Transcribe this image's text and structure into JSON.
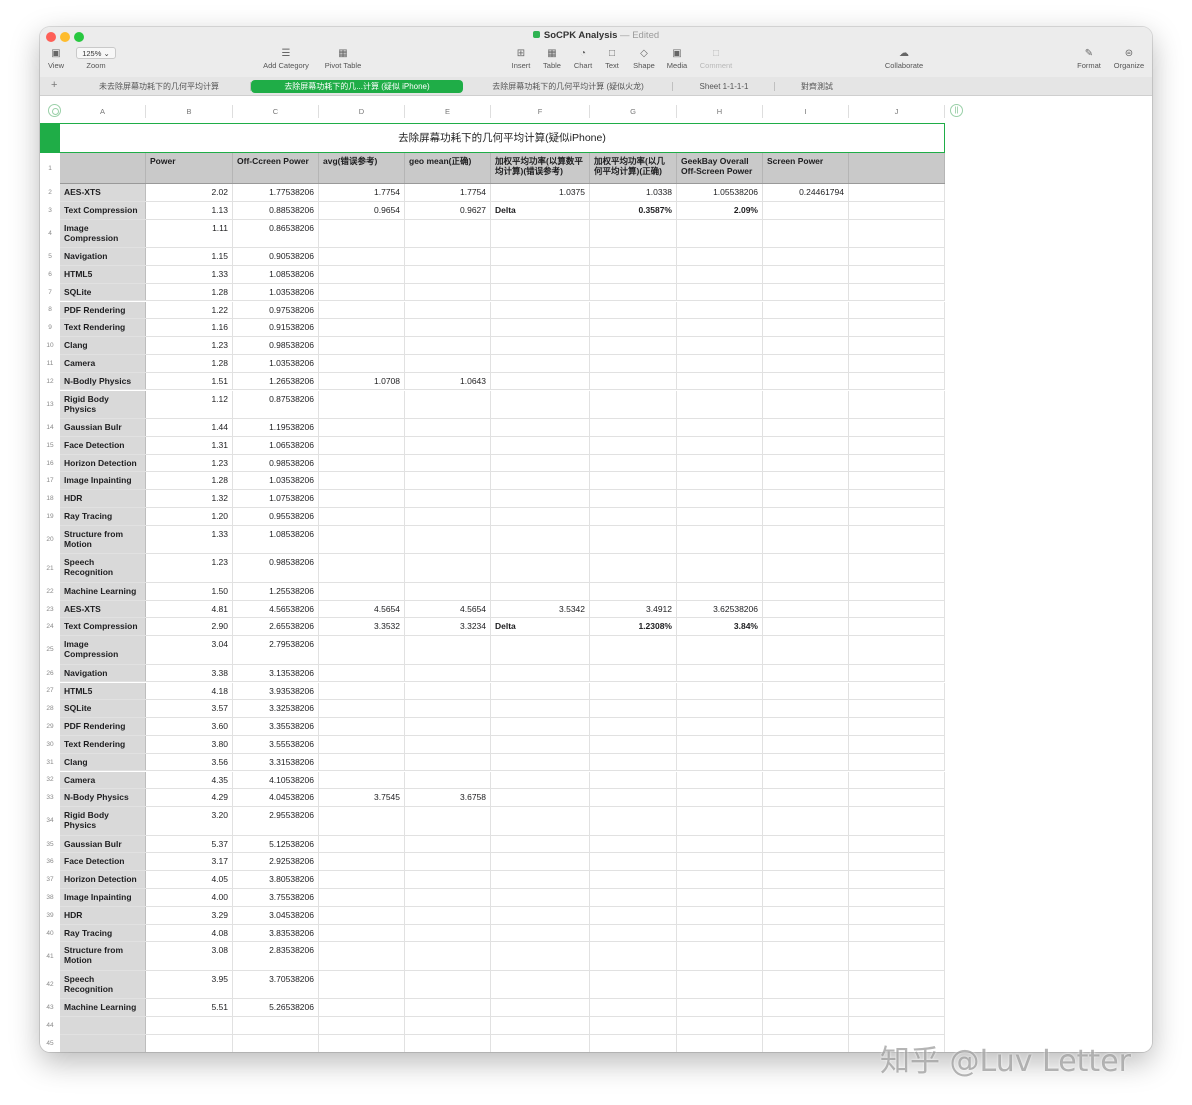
{
  "window": {
    "title": "SoCPK Analysis",
    "status": "Edited"
  },
  "toolbar": {
    "view": "View",
    "zoom_value": "125%",
    "zoom": "Zoom",
    "add_category": "Add Category",
    "pivot_table": "Pivot Table",
    "insert": "Insert",
    "table": "Table",
    "chart": "Chart",
    "text": "Text",
    "shape": "Shape",
    "media": "Media",
    "comment": "Comment",
    "collaborate": "Collaborate",
    "format": "Format",
    "organize": "Organize"
  },
  "sheets": [
    "未去除屏幕功耗下的几何平均计算",
    "去除屏幕功耗下的几...计算 (疑似 iPhone)",
    "去除屏幕功耗下的几何平均计算 (疑似火龙)",
    "Sheet 1-1-1-1",
    "對齊測試"
  ],
  "columns": [
    "A",
    "B",
    "C",
    "D",
    "E",
    "F",
    "G",
    "H",
    "I",
    "J"
  ],
  "table_title": "去除屏幕功耗下的几何平均计算(疑似iPhone)",
  "header": [
    "",
    "Power",
    "Off-Ccreen Power",
    "avg(错误参考)",
    "geo mean(正确)",
    "加权平均功率(以算数平均计算)(错误参考)",
    "加权平均功率(以几何平均计算)(正确)",
    "GeekBay Overall Off-Screen Power",
    "Screen Power",
    ""
  ],
  "rows": [
    [
      "AES-XTS",
      "2.02",
      "1.77538206",
      "1.7754",
      "1.7754",
      "1.0375",
      "1.0338",
      "1.05538206",
      "0.24461794",
      ""
    ],
    [
      "Text Compression",
      "1.13",
      "0.88538206",
      "0.9654",
      "0.9627",
      "Delta",
      "0.3587%",
      "2.09%",
      "",
      ""
    ],
    [
      "Image Compression",
      "1.11",
      "0.86538206",
      "",
      "",
      "",
      "",
      "",
      "",
      ""
    ],
    [
      "Navigation",
      "1.15",
      "0.90538206",
      "",
      "",
      "",
      "",
      "",
      "",
      ""
    ],
    [
      "HTML5",
      "1.33",
      "1.08538206",
      "",
      "",
      "",
      "",
      "",
      "",
      ""
    ],
    [
      "SQLite",
      "1.28",
      "1.03538206",
      "",
      "",
      "",
      "",
      "",
      "",
      ""
    ],
    [
      "PDF Rendering",
      "1.22",
      "0.97538206",
      "",
      "",
      "",
      "",
      "",
      "",
      ""
    ],
    [
      "Text Rendering",
      "1.16",
      "0.91538206",
      "",
      "",
      "",
      "",
      "",
      "",
      ""
    ],
    [
      "Clang",
      "1.23",
      "0.98538206",
      "",
      "",
      "",
      "",
      "",
      "",
      ""
    ],
    [
      "Camera",
      "1.28",
      "1.03538206",
      "",
      "",
      "",
      "",
      "",
      "",
      ""
    ],
    [
      "N-Bodly Physics",
      "1.51",
      "1.26538206",
      "1.0708",
      "1.0643",
      "",
      "",
      "",
      "",
      ""
    ],
    [
      "Rigid Body Physics",
      "1.12",
      "0.87538206",
      "",
      "",
      "",
      "",
      "",
      "",
      ""
    ],
    [
      "Gaussian Bulr",
      "1.44",
      "1.19538206",
      "",
      "",
      "",
      "",
      "",
      "",
      ""
    ],
    [
      "Face Detection",
      "1.31",
      "1.06538206",
      "",
      "",
      "",
      "",
      "",
      "",
      ""
    ],
    [
      "Horizon Detection",
      "1.23",
      "0.98538206",
      "",
      "",
      "",
      "",
      "",
      "",
      ""
    ],
    [
      "Image Inpainting",
      "1.28",
      "1.03538206",
      "",
      "",
      "",
      "",
      "",
      "",
      ""
    ],
    [
      "HDR",
      "1.32",
      "1.07538206",
      "",
      "",
      "",
      "",
      "",
      "",
      ""
    ],
    [
      "Ray Tracing",
      "1.20",
      "0.95538206",
      "",
      "",
      "",
      "",
      "",
      "",
      ""
    ],
    [
      "Structure from Motion",
      "1.33",
      "1.08538206",
      "",
      "",
      "",
      "",
      "",
      "",
      ""
    ],
    [
      "Speech Recognition",
      "1.23",
      "0.98538206",
      "",
      "",
      "",
      "",
      "",
      "",
      ""
    ],
    [
      "Machine Learning",
      "1.50",
      "1.25538206",
      "",
      "",
      "",
      "",
      "",
      "",
      ""
    ],
    [
      "AES-XTS",
      "4.81",
      "4.56538206",
      "4.5654",
      "4.5654",
      "3.5342",
      "3.4912",
      "3.62538206",
      "",
      ""
    ],
    [
      "Text Compression",
      "2.90",
      "2.65538206",
      "3.3532",
      "3.3234",
      "Delta",
      "1.2308%",
      "3.84%",
      "",
      ""
    ],
    [
      "Image Compression",
      "3.04",
      "2.79538206",
      "",
      "",
      "",
      "",
      "",
      "",
      ""
    ],
    [
      "Navigation",
      "3.38",
      "3.13538206",
      "",
      "",
      "",
      "",
      "",
      "",
      ""
    ],
    [
      "HTML5",
      "4.18",
      "3.93538206",
      "",
      "",
      "",
      "",
      "",
      "",
      ""
    ],
    [
      "SQLite",
      "3.57",
      "3.32538206",
      "",
      "",
      "",
      "",
      "",
      "",
      ""
    ],
    [
      "PDF Rendering",
      "3.60",
      "3.35538206",
      "",
      "",
      "",
      "",
      "",
      "",
      ""
    ],
    [
      "Text Rendering",
      "3.80",
      "3.55538206",
      "",
      "",
      "",
      "",
      "",
      "",
      ""
    ],
    [
      "Clang",
      "3.56",
      "3.31538206",
      "",
      "",
      "",
      "",
      "",
      "",
      ""
    ],
    [
      "Camera",
      "4.35",
      "4.10538206",
      "",
      "",
      "",
      "",
      "",
      "",
      ""
    ],
    [
      "N-Body Physics",
      "4.29",
      "4.04538206",
      "3.7545",
      "3.6758",
      "",
      "",
      "",
      "",
      ""
    ],
    [
      "Rigid Body Physics",
      "3.20",
      "2.95538206",
      "",
      "",
      "",
      "",
      "",
      "",
      ""
    ],
    [
      "Gaussian Bulr",
      "5.37",
      "5.12538206",
      "",
      "",
      "",
      "",
      "",
      "",
      ""
    ],
    [
      "Face Detection",
      "3.17",
      "2.92538206",
      "",
      "",
      "",
      "",
      "",
      "",
      ""
    ],
    [
      "Horizon Detection",
      "4.05",
      "3.80538206",
      "",
      "",
      "",
      "",
      "",
      "",
      ""
    ],
    [
      "Image Inpainting",
      "4.00",
      "3.75538206",
      "",
      "",
      "",
      "",
      "",
      "",
      ""
    ],
    [
      "HDR",
      "3.29",
      "3.04538206",
      "",
      "",
      "",
      "",
      "",
      "",
      ""
    ],
    [
      "Ray Tracing",
      "4.08",
      "3.83538206",
      "",
      "",
      "",
      "",
      "",
      "",
      ""
    ],
    [
      "Structure from Motion",
      "3.08",
      "2.83538206",
      "",
      "",
      "",
      "",
      "",
      "",
      ""
    ],
    [
      "Speech Recognition",
      "3.95",
      "3.70538206",
      "",
      "",
      "",
      "",
      "",
      "",
      ""
    ],
    [
      "Machine Learning",
      "5.51",
      "5.26538206",
      "",
      "",
      "",
      "",
      "",
      "",
      ""
    ],
    [
      "",
      "",
      "",
      "",
      "",
      "",
      "",
      "",
      "",
      ""
    ],
    [
      "",
      "",
      "",
      "",
      "",
      "",
      "",
      "",
      "",
      ""
    ]
  ],
  "bold_cells": [
    [
      1,
      6
    ],
    [
      1,
      7
    ],
    [
      1,
      8
    ],
    [
      22,
      6
    ],
    [
      22,
      7
    ]
  ],
  "watermark": "知乎 @Luv Letter"
}
